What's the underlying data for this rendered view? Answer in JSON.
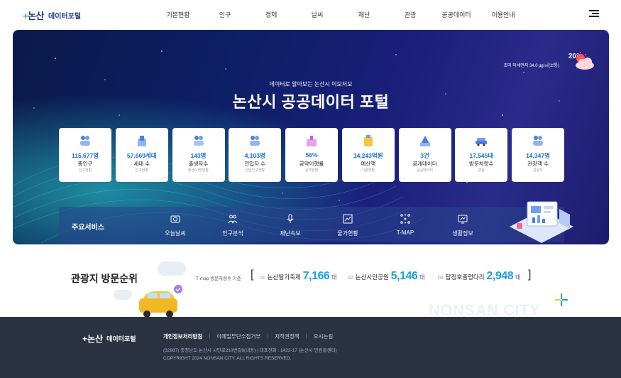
{
  "header": {
    "logo_mark": "논산",
    "logo_text": "데이터포털",
    "nav": [
      "기본현황",
      "인구",
      "경제",
      "날씨",
      "재난",
      "관광",
      "공공데이터",
      "이용안내"
    ]
  },
  "hero": {
    "weather_temp": "20°",
    "weather_dust": "초미 미세먼지 34.0 ㎍/㎥(보통)",
    "subtitle": "데이터로 알아보는 논산시 이모저모",
    "title": "논산시 공공데이터 포털",
    "cards": [
      {
        "icon": "people-icon",
        "value": "115,677명",
        "label": "총인구",
        "sub": "인구현황"
      },
      {
        "icon": "household-icon",
        "value": "57,669세대",
        "label": "세대 수",
        "sub": "인구현황"
      },
      {
        "icon": "birth-icon",
        "value": "143명",
        "label": "출생자수",
        "sub": "출생/사망현황"
      },
      {
        "icon": "move-in-icon",
        "value": "4,103명",
        "label": "전입자 수",
        "sub": "전입인구현황"
      },
      {
        "icon": "pledge-icon",
        "value": "56%",
        "label": "공약이행률",
        "sub": "공약현황"
      },
      {
        "icon": "budget-icon",
        "value": "14,243억원",
        "label": "예산액",
        "sub": "기본현황"
      },
      {
        "icon": "open-data-icon",
        "value": "3건",
        "label": "공개데이터",
        "sub": "공공데이터"
      },
      {
        "icon": "car-icon",
        "value": "17,545대",
        "label": "방문차량수",
        "sub": "관광"
      },
      {
        "icon": "tourist-icon",
        "value": "14,347명",
        "label": "관광객 수",
        "sub": "관광지"
      }
    ],
    "services_title": "주요서비스",
    "services": [
      {
        "icon": "camera-icon",
        "label": "오늘날씨"
      },
      {
        "icon": "population-analysis-icon",
        "label": "인구분석"
      },
      {
        "icon": "microphone-icon",
        "label": "재난속보"
      },
      {
        "icon": "price-chart-icon",
        "label": "물가현황"
      },
      {
        "icon": "network-icon",
        "label": "T-MAP"
      },
      {
        "icon": "life-info-icon",
        "label": "생활정보"
      }
    ]
  },
  "ranking": {
    "title": "관광지 방문순위",
    "basis": "T-map 방문차량수 기준",
    "items": [
      {
        "no": "01",
        "name": "논산딸기축제",
        "value": "7,166",
        "unit": "대"
      },
      {
        "no": "02",
        "name": "논산시민공원",
        "value": "5,146",
        "unit": "대"
      },
      {
        "no": "03",
        "name": "탑정호출렁다리",
        "value": "2,948",
        "unit": "대"
      }
    ],
    "bg_text": "NONSAN CITY"
  },
  "footer": {
    "logo_mark": "논산",
    "logo_text": "데이터포털",
    "links": [
      "개인정보처리방침",
      "이메일무단수집거부",
      "저작권정책",
      "오시는길"
    ],
    "address": "(32987) 충청남도 논산시 시민로210번길9(내동)   |   대표전화 : 1422-17 (논산시 민원콜센터)",
    "copyright": "COPYRIGHT 2024 NONSAN CITY, ALL RIGHTS RESERVED."
  },
  "colors": {
    "accent": "#1a6fd8",
    "rank_value": "#1ea0d8",
    "hero_bg": "#0d1f66",
    "footer_bg": "#2b3342"
  }
}
